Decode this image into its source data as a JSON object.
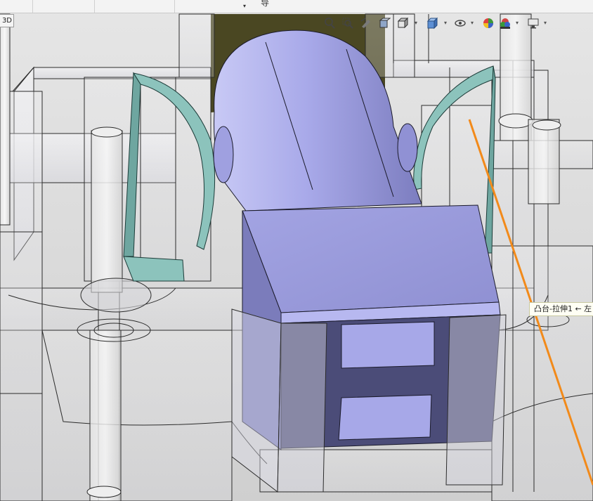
{
  "topbar": {
    "label": "导",
    "dropdown_caret": "▾"
  },
  "viewport": {
    "view_tab_label": "3D",
    "tooltip_text": "凸台-拉伸1 ← 左"
  },
  "hud_toolbar": {
    "icons": [
      "zoom-to-fit-icon",
      "zoom-to-area-icon",
      "previous-view-icon",
      "section-view-icon",
      "view-orientation-icon",
      "display-style-icon",
      "hide-show-items-icon",
      "edit-appearance-icon",
      "apply-scene-icon",
      "view-settings-icon"
    ]
  },
  "colors": {
    "part_body": "#a7a8e8",
    "part_body_dark": "#53547d",
    "highlight_orange": "#f28a1a",
    "teal_surface": "#7fbab3",
    "wireframe_line": "#2b2b2b",
    "transparent_mold": "#e8e8ea",
    "background": "#dcdcdc"
  }
}
